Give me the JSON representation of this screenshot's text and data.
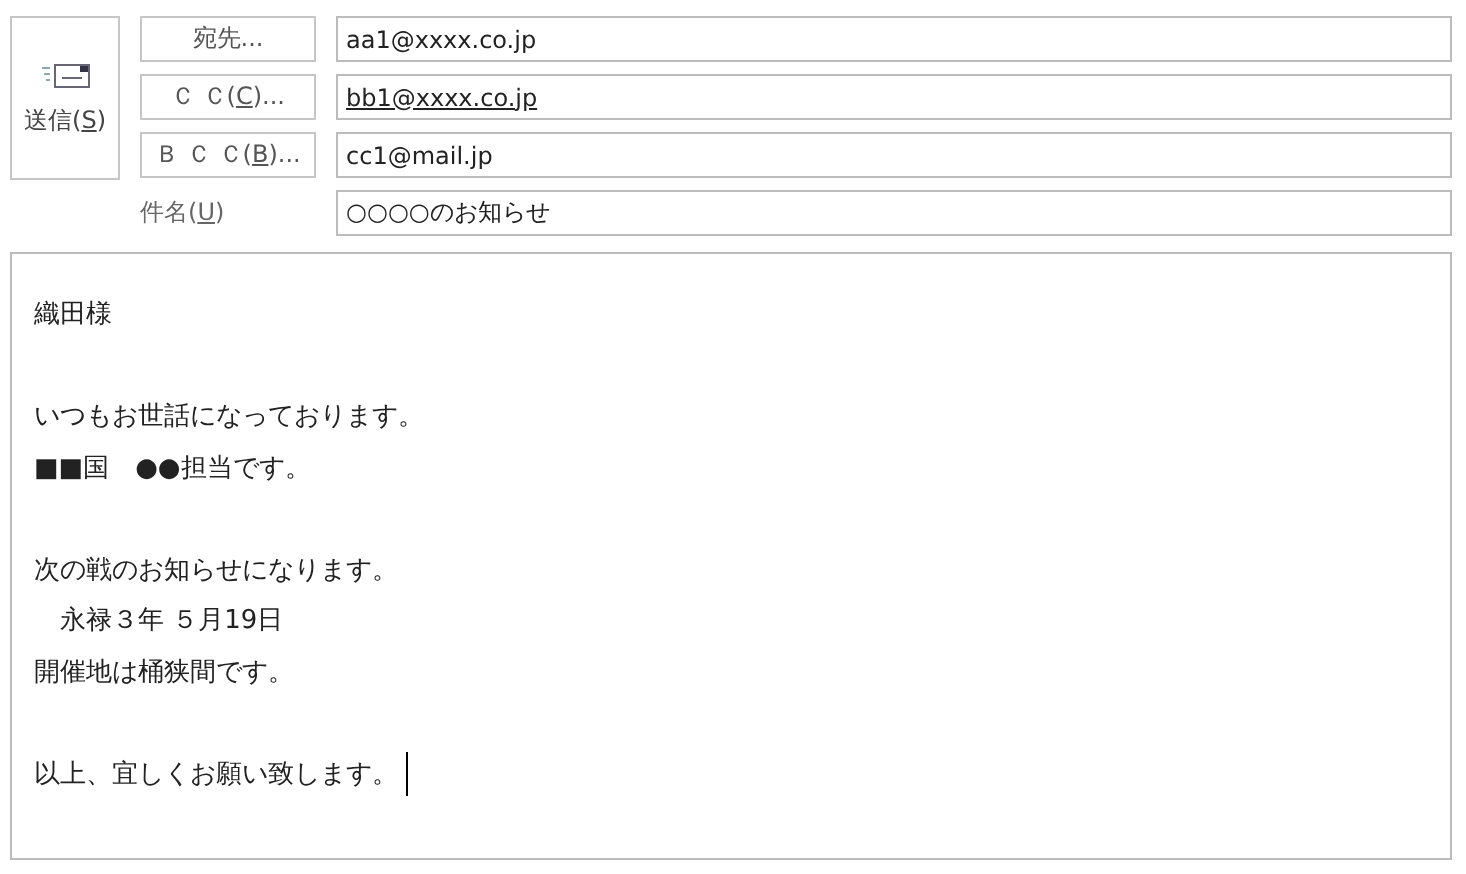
{
  "send_button": {
    "label": "送信(",
    "access_key": "S",
    "suffix": ")"
  },
  "address_rows": [
    {
      "button": {
        "label": "宛先..."
      },
      "value": "aa1@xxxx.co.jp",
      "resolved": false
    },
    {
      "button": {
        "label": "Ｃ Ｃ(",
        "access_key": "C",
        "suffix": ")..."
      },
      "value": "bb1@xxxx.co.jp",
      "resolved": true
    },
    {
      "button": {
        "label": "Ｂ Ｃ Ｃ(",
        "access_key": "B",
        "suffix": ")..."
      },
      "value": "cc1@mail.jp",
      "resolved": false
    }
  ],
  "subject": {
    "label": "件名(",
    "access_key": "U",
    "suffix": ")",
    "value": "○○○○のお知らせ"
  },
  "body": {
    "paragraphs": [
      [
        "織田様"
      ],
      [
        "いつもお世話になっております。",
        "■■国　●●担当です。"
      ],
      [
        "次の戦のお知らせになります。",
        "　永禄３年 ５月19日",
        "開催地は桶狭間です。"
      ],
      [
        "以上、宜しくお願い致します。"
      ]
    ],
    "cursor": true
  }
}
